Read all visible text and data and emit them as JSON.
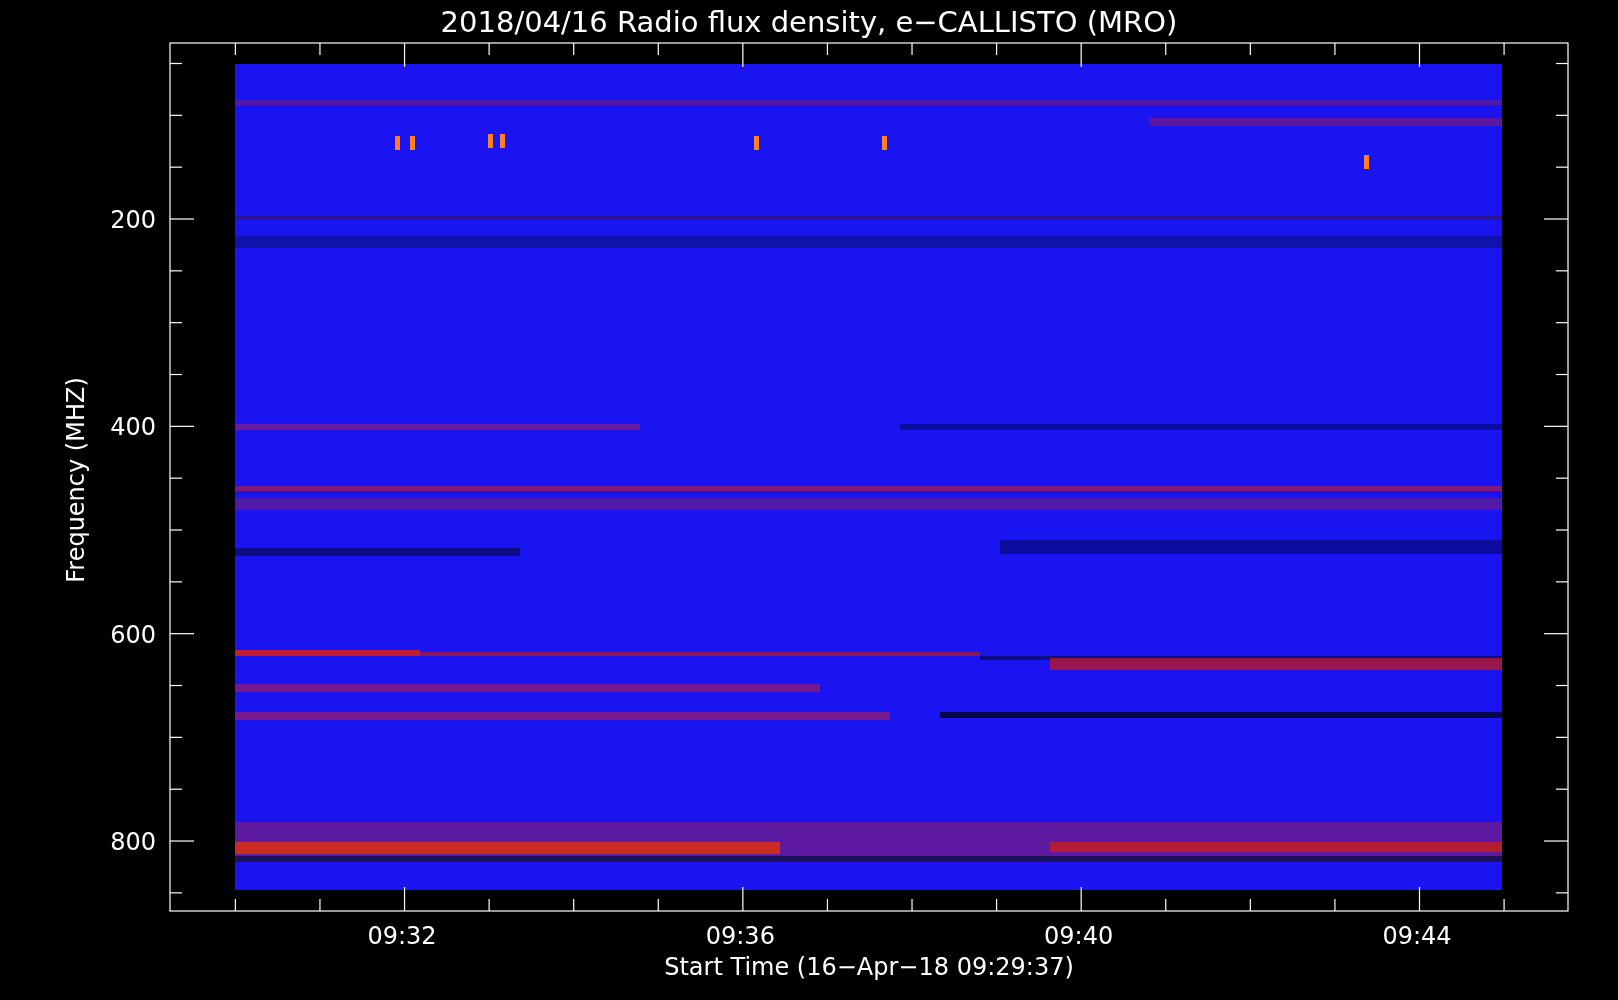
{
  "title": "2018/04/16  Radio flux density, e−CALLISTO (MRO)",
  "y_axis": {
    "label": "Frequency (MHZ)",
    "ticks": [
      "200",
      "400",
      "600",
      "800"
    ]
  },
  "x_axis": {
    "label": "Start Time (16−Apr−18 09:29:37)",
    "ticks": [
      "09:32",
      "09:36",
      "09:40",
      "09:44"
    ]
  }
}
